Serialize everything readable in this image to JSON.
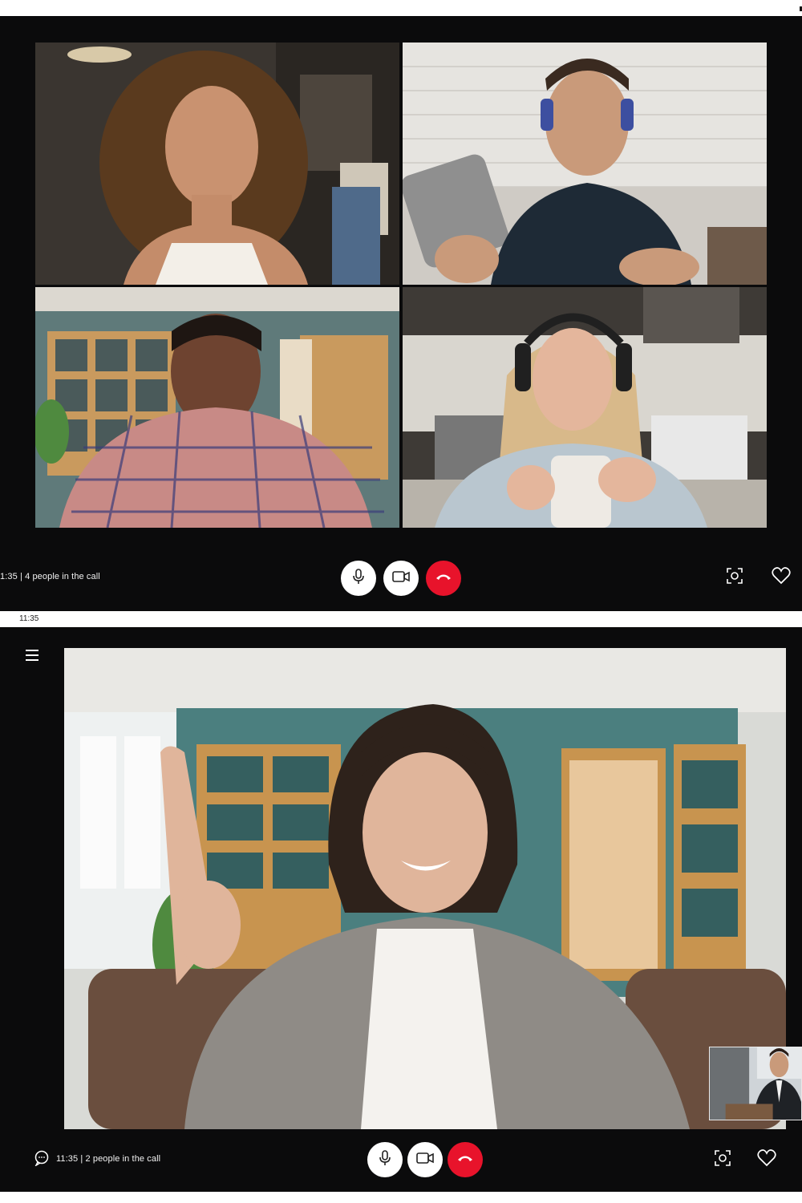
{
  "screens": [
    {
      "status": {
        "time": "1:35",
        "participants_text": "4 people in the call"
      },
      "participants": [
        {
          "desc": "woman-curly-hair-earphones"
        },
        {
          "desc": "man-blue-headphones"
        },
        {
          "desc": "man-plaid-shirt"
        },
        {
          "desc": "woman-headphones-mug"
        }
      ],
      "controls": {
        "mic": "mic-icon",
        "camera": "video-camera-icon",
        "end": "end-call-icon",
        "screenshot": "camera-focus-icon",
        "favorite": "heart-icon"
      }
    },
    {
      "time_label": "11:35",
      "status": {
        "time": "11:35",
        "participants_text": "2 people in the call"
      },
      "controls": {
        "menu": "hamburger-menu-icon",
        "chat": "chat-bubble-icon",
        "mic": "mic-icon",
        "camera": "video-camera-icon",
        "end": "end-call-icon",
        "screenshot": "camera-focus-icon",
        "favorite": "heart-icon"
      }
    }
  ],
  "status_line_top": "1:35 | 4 people in the call",
  "status_line_bottom": "11:35 | 2 people in the call",
  "colors": {
    "panel_bg": "#0b0b0c",
    "end_call_red": "#e8132b",
    "button_white": "#ffffff"
  }
}
